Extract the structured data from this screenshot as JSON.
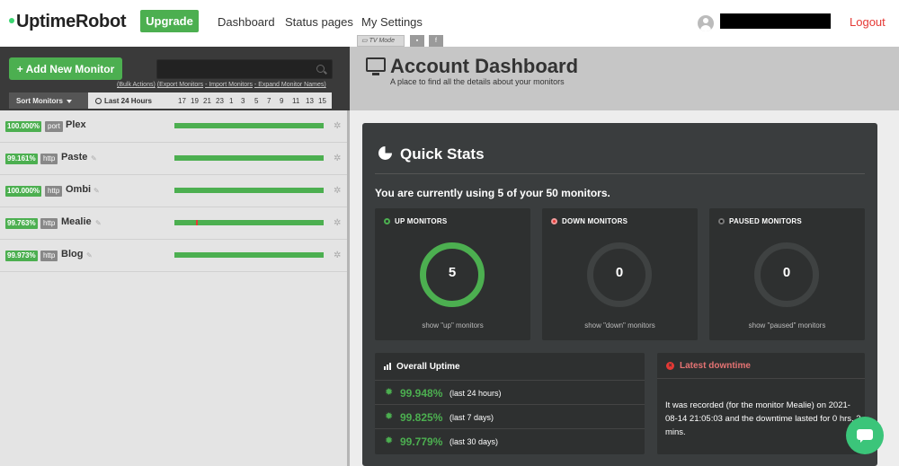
{
  "header": {
    "logo": "UptimeRobot",
    "upgrade_label": "Upgrade",
    "nav": [
      "Dashboard",
      "Status pages",
      "My Settings"
    ],
    "logout": "Logout"
  },
  "sidebar": {
    "add_label": "Add New Monitor",
    "bulk_links": [
      "(Bulk Actions)",
      "(Export Monitors",
      "- Import Monitors",
      "- Expand Monitor Names)"
    ],
    "sort_label": "Sort Monitors",
    "hours_label": "Last 24 Hours",
    "hour_ticks": [
      "17",
      "19",
      "21",
      "23",
      "1",
      "3",
      "5",
      "7",
      "9",
      "11",
      "13",
      "15"
    ],
    "monitors": [
      {
        "uptime": "100.000%",
        "type": "port",
        "name": "Plex",
        "uptime_fraction": 1.0
      },
      {
        "uptime": "99.161%",
        "type": "http",
        "name": "Paste",
        "uptime_fraction": 0.99161
      },
      {
        "uptime": "100.000%",
        "type": "http",
        "name": "Ombi",
        "uptime_fraction": 1.0
      },
      {
        "uptime": "99.763%",
        "type": "http",
        "name": "Mealie",
        "uptime_fraction": 0.99763
      },
      {
        "uptime": "99.973%",
        "type": "http",
        "name": "Blog",
        "uptime_fraction": 0.99973
      }
    ]
  },
  "tv": {
    "mode_label": "TV Mode"
  },
  "page": {
    "title": "Account Dashboard",
    "subtitle": "A place to find all the details about your monitors"
  },
  "quick_stats": {
    "title": "Quick Stats",
    "usage_line": "You are currently using 5 of your 50 monitors.",
    "cards": [
      {
        "label": "UP MONITORS",
        "count": "5",
        "footer": "show \"up\" monitors",
        "dot_color": "#4caf50",
        "ring_color": "#4caf50"
      },
      {
        "label": "DOWN MONITORS",
        "count": "0",
        "footer": "show \"down\" monitors",
        "dot_color": "#e53935",
        "ring_color": "#3a3c3c"
      },
      {
        "label": "PAUSED MONITORS",
        "count": "0",
        "footer": "show \"paused\" monitors",
        "dot_color": "#111111",
        "ring_color": "#3a3c3c"
      }
    ]
  },
  "overall_uptime": {
    "title": "Overall Uptime",
    "rows": [
      {
        "pct": "99.948%",
        "period": "(last 24 hours)"
      },
      {
        "pct": "99.825%",
        "period": "(last 7 days)"
      },
      {
        "pct": "99.779%",
        "period": "(last 30 days)"
      }
    ]
  },
  "latest_downtime": {
    "title": "Latest downtime",
    "text": "It was recorded (for the monitor Mealie) on 2021-08-14 21:05:03 and the downtime lasted for 0 hrs, 3 mins."
  },
  "colors": {
    "accent": "#4caf50",
    "danger": "#e53935",
    "panel": "#3a3d3e"
  }
}
